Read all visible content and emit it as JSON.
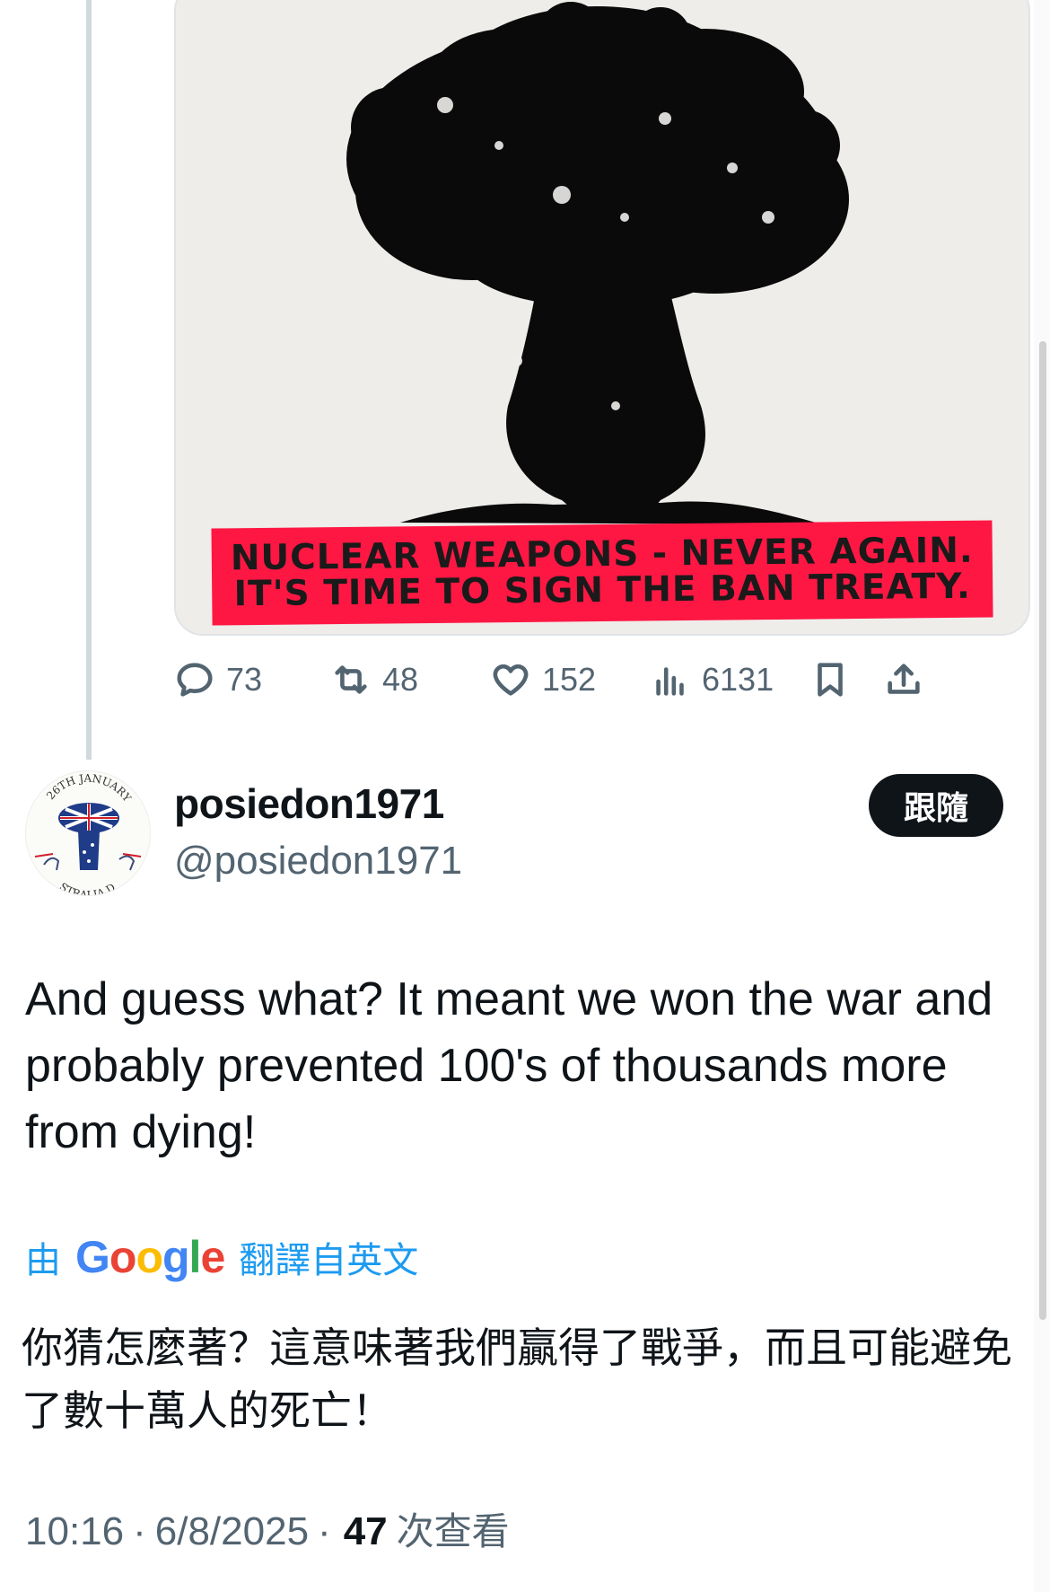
{
  "media": {
    "banner_line_1": "NUCLEAR WEAPONS - NEVER AGAIN.",
    "banner_line_2": "IT'S TIME TO SIGN THE BAN TREATY."
  },
  "actions": {
    "reply_count": "73",
    "repost_count": "48",
    "like_count": "152",
    "view_count": "6131",
    "icons": [
      "reply-icon",
      "repost-icon",
      "like-icon",
      "views-icon",
      "bookmark-icon",
      "share-icon"
    ]
  },
  "reply": {
    "display_name": "posiedon1971",
    "handle": "@posiedon1971",
    "follow_label": "跟隨",
    "avatar_text_top": "26TH JANUARY",
    "avatar_text_bottom": "STRALIA D",
    "text": "And guess what? It meant we won the war and probably prevented 100's of thousands more from dying!",
    "translation": {
      "by_label": "由",
      "google_label": "Google",
      "from_label": "翻譯自英文",
      "text": "你猜怎麼著？這意味著我們贏得了戰爭，而且可能避免了數十萬人的死亡！"
    },
    "meta": {
      "time": "10:16",
      "separator": "·",
      "date": "6/8/2025",
      "views": "47",
      "views_label": "次查看"
    }
  },
  "colors": {
    "accent": "#1d9bf0",
    "banner": "#ff1744",
    "muted": "#536471",
    "text": "#0f1419"
  }
}
